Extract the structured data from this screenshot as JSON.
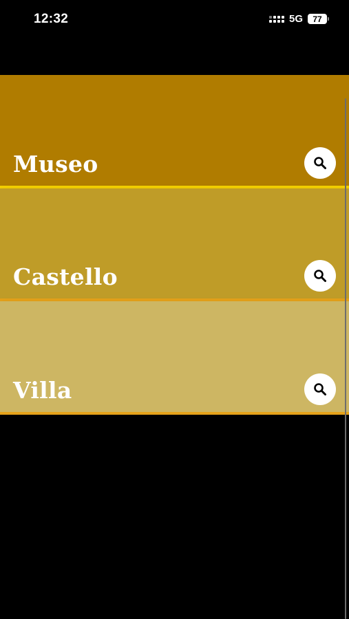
{
  "status_bar": {
    "time": "12:32",
    "network": "5G",
    "battery": "77"
  },
  "items": [
    {
      "label": "Museo",
      "icon": "search-icon",
      "color": "#b07c00",
      "accent": "#f5d000"
    },
    {
      "label": "Castello",
      "icon": "search-icon",
      "color": "#bf9c28",
      "accent": "#e6a21a"
    },
    {
      "label": "Villa",
      "icon": "search-icon",
      "color": "#cdb663",
      "accent": "#e6a21a"
    }
  ]
}
